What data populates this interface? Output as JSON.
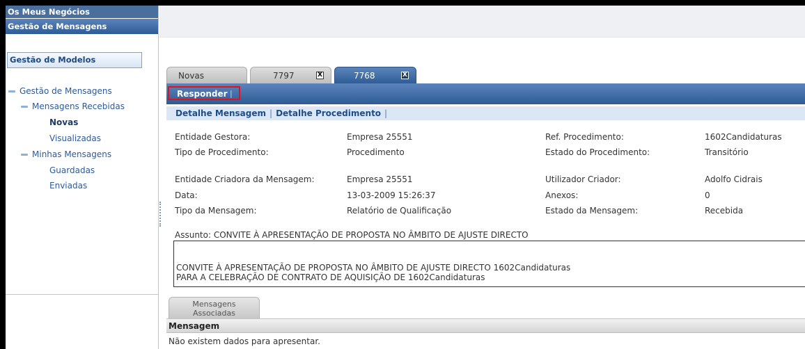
{
  "sidebar": {
    "header1": "Os Meus Negócios",
    "header2": "Gestão de Mensagens",
    "models_button": "Gestão de Modelos",
    "tree": {
      "root": "Gestão de Mensagens",
      "received": "Mensagens Recebidas",
      "new": "Novas",
      "viewed": "Visualizadas",
      "mine": "Minhas Mensagens",
      "saved": "Guardadas",
      "sent": "Enviadas"
    }
  },
  "tabs": [
    {
      "label": "Novas",
      "closable": false,
      "active": false
    },
    {
      "label": "7797",
      "closable": true,
      "active": false
    },
    {
      "label": "7768",
      "closable": true,
      "active": true
    }
  ],
  "close_glyph": "X",
  "actions": {
    "reply": "Responder",
    "separator": "|"
  },
  "subnav": {
    "detail_message": "Detalhe Mensagem",
    "detail_procedure": "Detalhe Procedimento",
    "separator": "|"
  },
  "details": {
    "entidade_gestora_label": "Entidade Gestora:",
    "entidade_gestora_value": "Empresa 25551",
    "ref_procedimento_label": "Ref. Procedimento:",
    "ref_procedimento_value": "1602Candidaturas",
    "tipo_procedimento_label": "Tipo de Procedimento:",
    "tipo_procedimento_value": "Procedimento",
    "estado_procedimento_label": "Estado do Procedimento:",
    "estado_procedimento_value": "Transitório",
    "entidade_criadora_label": "Entidade Criadora da Mensagem:",
    "entidade_criadora_value": "Empresa 25551",
    "utilizador_criador_label": "Utilizador Criador:",
    "utilizador_criador_value": "Adolfo Cidrais",
    "data_label": "Data:",
    "data_value": "13-03-2009 15:26:37",
    "anexos_label": "Anexos:",
    "anexos_value": "0",
    "tipo_mensagem_label": "Tipo da Mensagem:",
    "tipo_mensagem_value": "Relatório de Qualificação",
    "estado_mensagem_label": "Estado da Mensagem:",
    "estado_mensagem_value": "Recebida"
  },
  "subject": {
    "line": "Assunto: CONVITE À APRESENTAÇÃO DE PROPOSTA NO ÂMBITO DE AJUSTE DIRECTO",
    "body_line1": "CONVITE À APRESENTAÇÃO DE PROPOSTA NO ÂMBITO DE AJUSTE DIRECTO 1602Candidaturas",
    "body_line2": "PARA A CELEBRAÇÃO DE CONTRATO DE AQUISIÇÃO DE 1602Candidaturas"
  },
  "associated": {
    "tab_line1": "Mensagens",
    "tab_line2": "Associadas",
    "column_header": "Mensagem",
    "empty_message": "Não existem dados para apresentar."
  },
  "colors": {
    "accent_blue": "#3f6aa3",
    "highlight_red": "#e0131b",
    "subnav_bg": "#dce7f6"
  }
}
